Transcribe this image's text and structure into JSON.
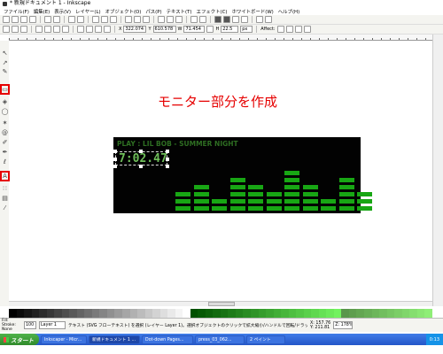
{
  "window": {
    "title": "* 新規ドキュメント 1 - Inkscape"
  },
  "menu": [
    "ファイル(F)",
    "編集(E)",
    "表示(V)",
    "レイヤー(L)",
    "オブジェクト(O)",
    "パス(P)",
    "テキスト(T)",
    "エフェクト(C)",
    "ホワイトボード(W)",
    "ヘルプ(H)"
  ],
  "toolbar": {
    "x_label": "X",
    "x_value": "322.074",
    "y_label": "Y",
    "y_value": "610.578",
    "w_label": "W",
    "w_value": "71.454",
    "h_label": "H",
    "h_value": "22.5",
    "unit": "px",
    "affect_label": "Affect:"
  },
  "canvas": {
    "heading": "モニター部分を作成"
  },
  "monitor": {
    "track_title": "PLAY : LIL BOB - SUMMER NIGHT",
    "time_display": "7:02.47",
    "colors": {
      "background": "#020202",
      "eq_bar": "#18a614",
      "title_text": "#2e6e22",
      "time_text": "#6fbf5a"
    },
    "equalizer_levels": [
      3,
      4,
      2,
      5,
      4,
      3,
      6,
      4,
      2,
      5,
      3
    ]
  },
  "statusbar": {
    "fill_label": "Fill:",
    "stroke_label": "Stroke:",
    "stroke_value": "None",
    "opacity_value": "100",
    "layer_value": "Layer 1",
    "message": "テキスト (SVG フローテキスト) を選択 (レイヤー Layer 1)。選択オブジェクトのクリックで拡大縮小/ハンドルで回転/ドラッグで移動",
    "coords_x": "X: 157.76",
    "coords_y": "Y: 211.81",
    "zoom": "Z: 178%"
  },
  "taskbar": {
    "start_label": "スタート",
    "items": [
      "Inkscaper - Micr...",
      "新規ドキュメント 1 ...",
      "Dot-down Pages...",
      "press_03_062...",
      "2 ペイント"
    ],
    "active_index": 1,
    "clock": "0:13"
  },
  "tools": [
    {
      "name": "selector-tool-icon",
      "glyph": "↖"
    },
    {
      "name": "node-tool-icon",
      "glyph": "↗"
    },
    {
      "name": "tweak-tool-icon",
      "glyph": "✎"
    },
    {
      "name": "zoom-tool-icon",
      "glyph": "⌕"
    },
    {
      "name": "rectangle-tool-icon",
      "glyph": "▭"
    },
    {
      "name": "3d-box-tool-icon",
      "glyph": "◈"
    },
    {
      "name": "ellipse-tool-icon",
      "glyph": "◯"
    },
    {
      "name": "star-tool-icon",
      "glyph": "✶"
    },
    {
      "name": "spiral-tool-icon",
      "glyph": "@"
    },
    {
      "name": "pencil-tool-icon",
      "glyph": "✐"
    },
    {
      "name": "pen-tool-icon",
      "glyph": "✒"
    },
    {
      "name": "calligraphy-tool-icon",
      "glyph": "ℓ"
    },
    {
      "name": "bucket-tool-icon",
      "glyph": "◐"
    },
    {
      "name": "text-tool-icon",
      "glyph": "A"
    },
    {
      "name": "spray-tool-icon",
      "glyph": "∷"
    },
    {
      "name": "gradient-tool-icon",
      "glyph": "▤"
    },
    {
      "name": "dropper-tool-icon",
      "glyph": "⁄"
    }
  ]
}
